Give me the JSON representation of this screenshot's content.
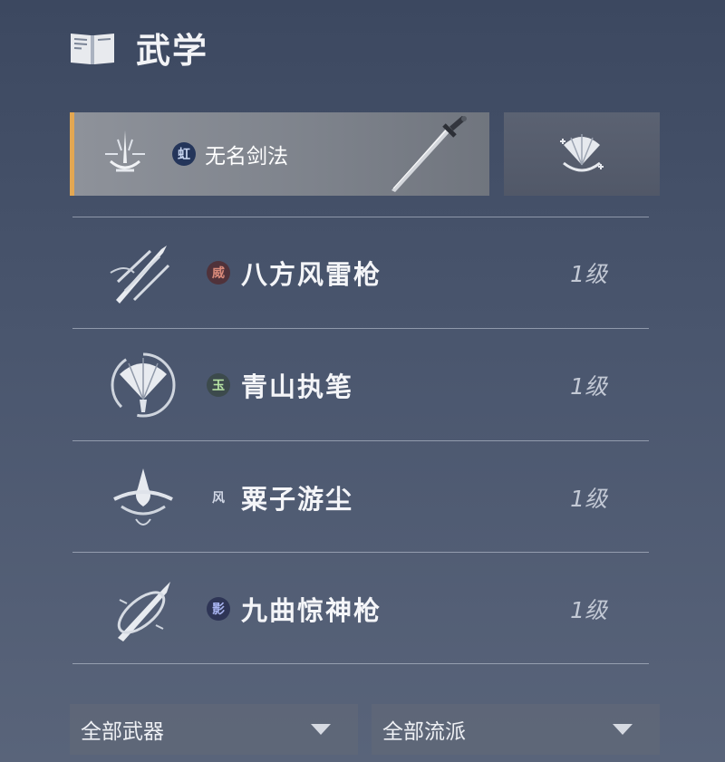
{
  "header": {
    "title": "武学",
    "icon": "book-icon"
  },
  "equipped": {
    "badge": "虹",
    "name": "无名剑法",
    "icon": "sword-stance-icon",
    "weapon_icon": "sword-icon"
  },
  "side_slot": {
    "icon": "fan-plus-icon"
  },
  "skills": [
    {
      "badge": "威",
      "badge_color": "#d98a7a",
      "name": "八方风雷枪",
      "level": "1级",
      "icon": "spear-thrust-icon"
    },
    {
      "badge": "玉",
      "badge_color": "#b7e4a4",
      "name": "青山执笔",
      "level": "1级",
      "icon": "fan-icon"
    },
    {
      "badge": "风",
      "badge_color": "#d2d8e6",
      "name": "粟子游尘",
      "level": "1级",
      "icon": "whirl-icon"
    },
    {
      "badge": "影",
      "badge_color": "#a8b4f0",
      "name": "九曲惊神枪",
      "level": "1级",
      "icon": "spear-spiral-icon"
    }
  ],
  "filters": {
    "weapon": "全部武器",
    "school": "全部流派"
  },
  "colors": {
    "accent": "#e3a752"
  }
}
